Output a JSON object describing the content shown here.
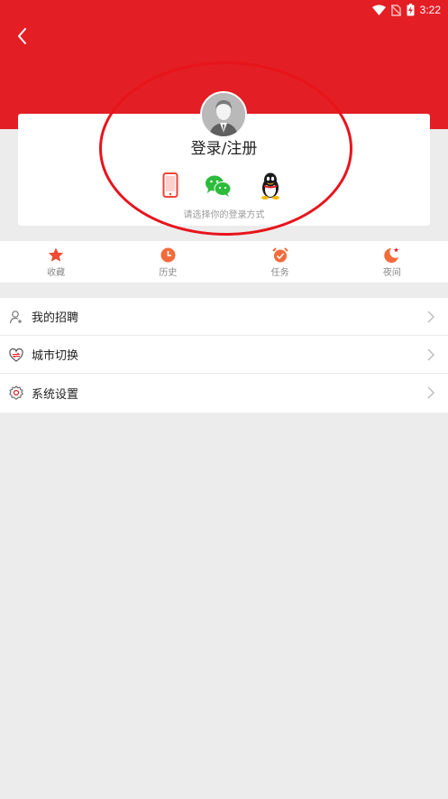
{
  "status_bar": {
    "time": "3:22",
    "icons": [
      "wifi-icon",
      "no-sim-icon",
      "battery-charging-icon"
    ]
  },
  "header": {
    "back_icon": "chevron-left-icon",
    "color": "#e31e24"
  },
  "login": {
    "title": "登录/注册",
    "hint": "请选择你的登录方式",
    "methods": [
      {
        "name": "phone",
        "icon": "phone-icon"
      },
      {
        "name": "wechat",
        "icon": "wechat-icon"
      },
      {
        "name": "qq",
        "icon": "qq-icon"
      }
    ]
  },
  "quickbar": [
    {
      "label": "收藏",
      "icon": "star-icon"
    },
    {
      "label": "历史",
      "icon": "clock-icon"
    },
    {
      "label": "任务",
      "icon": "alarm-check-icon"
    },
    {
      "label": "夜间",
      "icon": "moon-icon"
    }
  ],
  "menu": [
    {
      "label": "我的招聘",
      "icon": "person-add-icon"
    },
    {
      "label": "城市切换",
      "icon": "city-switch-icon"
    },
    {
      "label": "系统设置",
      "icon": "gear-icon"
    }
  ],
  "colors": {
    "brand": "#e31e24",
    "annotation": "#e8141c",
    "accent_orange": "#f26b3a",
    "wechat": "#2dbb3c"
  }
}
